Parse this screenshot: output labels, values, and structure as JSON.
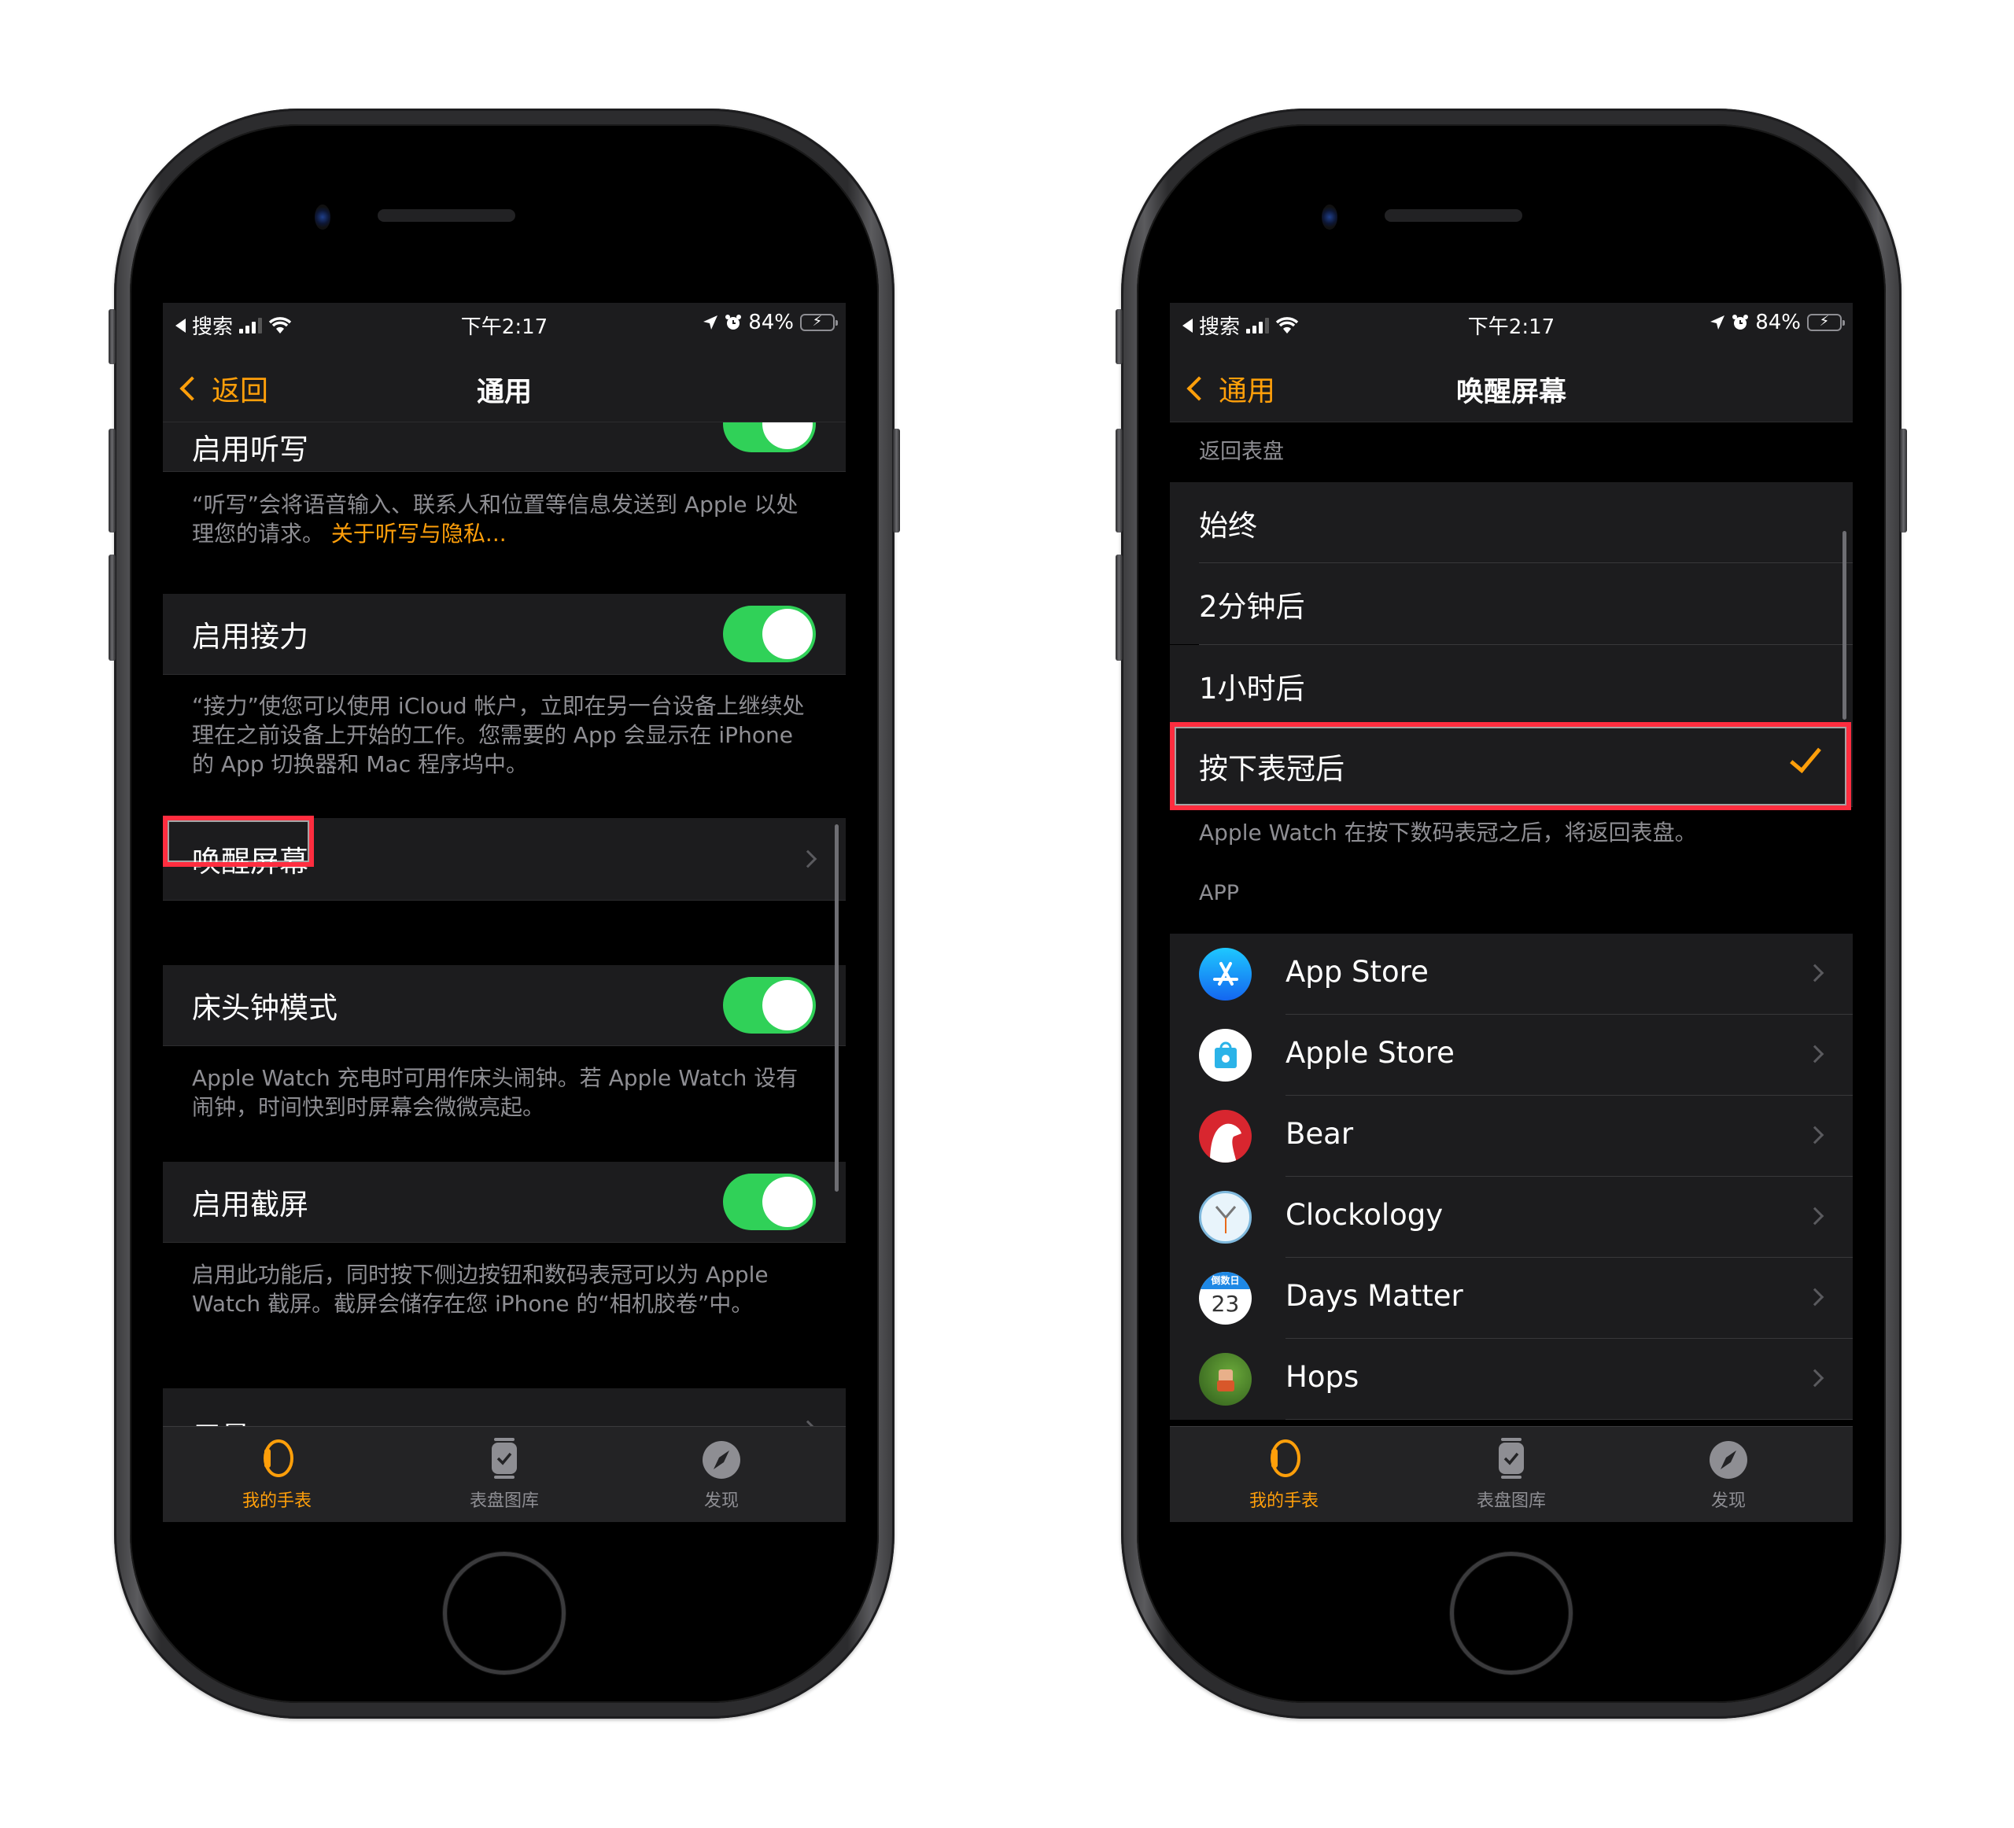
{
  "status_bar": {
    "back_app": "搜索",
    "time": "下午2:17",
    "battery_percent": "84%",
    "signal_bars": 3,
    "signal_bars_total": 4,
    "battery_level": 0.84,
    "charging": true,
    "icons": [
      "back-triangle-icon",
      "signal-icon",
      "wifi-icon",
      "location-icon",
      "alarm-icon",
      "battery-charging-icon"
    ]
  },
  "left_screen": {
    "nav": {
      "back_label": "返回",
      "title": "通用"
    },
    "items": [
      {
        "label": "启用听写",
        "type": "toggle",
        "on": true,
        "footer": "“听写”会将语音输入、联系人和位置等信息发送到 Apple 以处理您的请求。",
        "footer_link": "关于听写与隐私..."
      },
      {
        "label": "启用接力",
        "type": "toggle",
        "on": true,
        "footer": "“接力”使您可以使用 iCloud 帐户，立即在另一台设备上继续处理在之前设备上开始的工作。您需要的 App 会显示在 iPhone 的 App 切换器和 Mac 程序坞中。"
      },
      {
        "label": "唤醒屏幕",
        "type": "disclosure",
        "highlighted": true
      },
      {
        "label": "床头钟模式",
        "type": "toggle",
        "on": true,
        "footer": "Apple Watch 充电时可用作床头闹钟。若 Apple Watch 设有闹钟，时间快到时屏幕会微微亮起。"
      },
      {
        "label": "启用截屏",
        "type": "toggle",
        "on": true,
        "footer": "启用此功能后，同时按下侧边按钮和数码表冠可以为 Apple Watch 截屏。截屏会储存在您 iPhone 的“相机胶卷”中。"
      },
      {
        "label": "用量",
        "type": "disclosure"
      }
    ]
  },
  "right_screen": {
    "nav": {
      "back_label": "通用",
      "title": "唤醒屏幕"
    },
    "return_section": {
      "header": "返回表盘",
      "options": [
        {
          "label": "始终",
          "selected": false
        },
        {
          "label": "2分钟后",
          "selected": false
        },
        {
          "label": "1小时后",
          "selected": false
        },
        {
          "label": "按下表冠后",
          "selected": true
        }
      ],
      "footer": "Apple Watch 在按下数码表冠之后，将返回表盘。"
    },
    "app_section": {
      "header": "APP",
      "apps": [
        {
          "name": "App Store",
          "icon": "app-store-icon",
          "color": "#1a8cff"
        },
        {
          "name": "Apple Store",
          "icon": "apple-store-icon",
          "color": "#2bb3e8"
        },
        {
          "name": "Bear",
          "icon": "bear-icon",
          "color": "#d8262f"
        },
        {
          "name": "Clockology",
          "icon": "clockology-icon",
          "color": "#e8f4fb"
        },
        {
          "name": "Days Matter",
          "icon": "days-matter-icon",
          "color": "#1e88e5",
          "badge_top": "倒数日",
          "badge_num": "23"
        },
        {
          "name": "Hops",
          "icon": "hops-icon",
          "color": "#4a7a2e"
        }
      ]
    }
  },
  "tab_bar": {
    "tabs": [
      {
        "label": "我的手表",
        "icon": "my-watch-icon",
        "active": true
      },
      {
        "label": "表盘图库",
        "icon": "face-gallery-icon",
        "active": false
      },
      {
        "label": "发现",
        "icon": "discover-compass-icon",
        "active": false
      }
    ]
  },
  "colors": {
    "accent": "#ff9f0a",
    "toggle_on": "#30d158",
    "highlight_box": "#ff2d3f",
    "cell_bg": "#1c1c1e",
    "secondary_text": "#8e8e93"
  }
}
